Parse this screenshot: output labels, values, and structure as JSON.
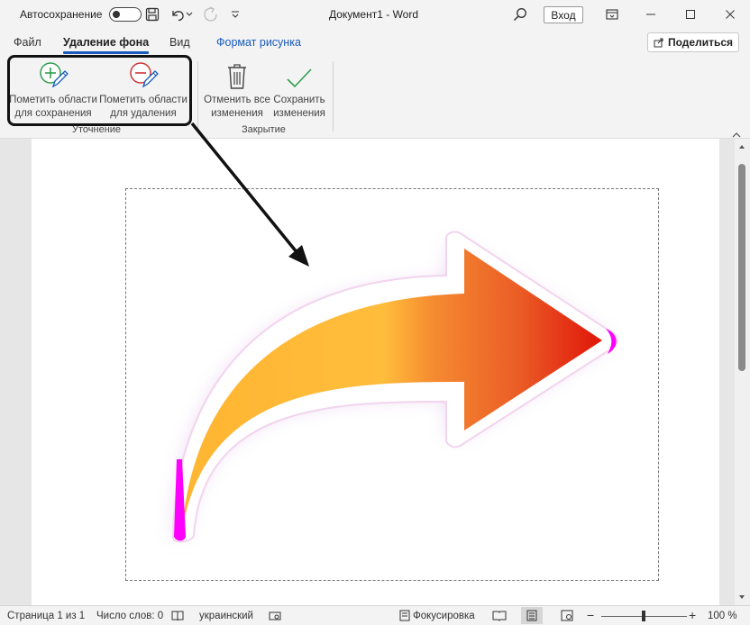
{
  "titlebar": {
    "autosave_label": "Автосохранение",
    "doc_title": "Документ1  -  Word",
    "login_label": "Вход"
  },
  "tabs": [
    {
      "label": "Файл"
    },
    {
      "label": "Удаление фона"
    },
    {
      "label": "Вид"
    },
    {
      "label": "Формат рисунка"
    }
  ],
  "share_label": "Поделиться",
  "ribbon": {
    "mark_keep_line1": "Пометить области",
    "mark_keep_line2": "для сохранения",
    "mark_remove_line1": "Пометить области",
    "mark_remove_line2": "для удаления",
    "discard_line1": "Отменить все",
    "discard_line2": "изменения",
    "save_line1": "Сохранить",
    "save_line2": "изменения",
    "group_refine": "Уточнение",
    "group_close": "Закрытие"
  },
  "statusbar": {
    "page": "Страница 1 из 1",
    "words": "Число слов: 0",
    "language": "украинский",
    "focus": "Фокусировка",
    "zoom": "100 %"
  },
  "colors": {
    "accent": "#185abd",
    "keep_icon": "#2e9e4f",
    "remove_icon": "#d13438",
    "arrow_start": "#ffc23e",
    "arrow_end": "#e0150a",
    "removed_area": "#ff00ff"
  },
  "icons": [
    "undo-icon",
    "redo-icon",
    "save-icon",
    "search-icon",
    "share-icon",
    "trash-icon",
    "checkmark-icon",
    "pencil-plus-icon",
    "pencil-minus-icon"
  ]
}
